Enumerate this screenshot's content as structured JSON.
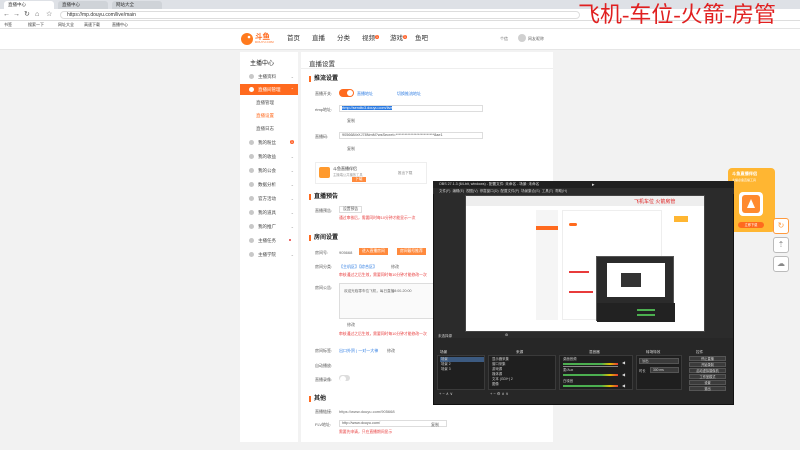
{
  "browser": {
    "tabs": [
      "直播中心",
      "直播中心",
      "网站大全"
    ],
    "url": "https://mp.douyu.com/live/main",
    "bookmarks": [
      "书签",
      "搜索一下",
      "网址大全",
      "高速下载",
      "直播中心"
    ],
    "user": "网友昵称"
  },
  "overlay_text": "飞机-车位-火箭-房管",
  "site": {
    "logo": "斗鱼",
    "logo_sub": "DOUYU.COM",
    "nav": [
      "首页",
      "直播",
      "分类",
      "视频",
      "游戏",
      "鱼吧"
    ],
    "nav_badges": {
      "视频": "1",
      "游戏": "1"
    },
    "msg": "个信"
  },
  "sidebar": {
    "title": "主播中心",
    "items": [
      {
        "label": "主播资料"
      },
      {
        "label": "直播间管理",
        "active": true
      },
      {
        "label": "直播管理",
        "sub": true
      },
      {
        "label": "直播设置",
        "sub": true,
        "active": true
      },
      {
        "label": "直播日志",
        "sub": true
      },
      {
        "label": "我的粉丝",
        "badge": "1"
      },
      {
        "label": "我的收益"
      },
      {
        "label": "我的公会"
      },
      {
        "label": "数据分析"
      },
      {
        "label": "官方活动"
      },
      {
        "label": "我的道具"
      },
      {
        "label": "我的推广"
      },
      {
        "label": "主播任务"
      },
      {
        "label": "主播学院"
      }
    ]
  },
  "main": {
    "page_title": "直播设置",
    "push": {
      "heading": "推流设置",
      "switch_label": "直播开关:",
      "link1": "直播地址",
      "link2": "切换推流地址",
      "rtmp_label": "rtmp地址:",
      "rtmp_value": "rtmp://sendtc3.douyu.com/live",
      "copy": "复制",
      "code_label": "直播码:",
      "code_value": "9056684rXJ78NmM?wsSecret=**************************8ae1",
      "helper_title": "斗鱼直播伴侣",
      "helper_desc": "主播端公共播放工具",
      "helper_btn": "下载",
      "helper_right": "推出下载"
    },
    "notice": {
      "heading": "直播预告",
      "label": "直播预告:",
      "btn": "设置预告",
      "warn": "通过审核后，需要同时每10分钟才能显示一次"
    },
    "room": {
      "heading": "房间设置",
      "id_label": "房间号:",
      "id_value": "905668",
      "btn_apply": "进入直播房间",
      "btn_seat": "房间靓号推荐",
      "cat_label": "房间分类:",
      "cat_value": "【主机区】【综合区】",
      "cat_btn": "修改",
      "cat_warn": "审核通过之后生效，需要同时每10分钟才能修改一次",
      "desc_label": "房间公告:",
      "desc_value": "欢迎光临零车位飞机，每日直播8:00-20:00",
      "edit": "修改",
      "desc_warn": "审核通过之后生效，需要同时每10分钟才能修改一次",
      "tag_label": "房间标签:",
      "tag_value": "出口外贸 | 一对一大神",
      "tag_btn": "修改",
      "auto_label": "自动播放:",
      "record_label": "直播录像:"
    },
    "other": {
      "heading": "其他",
      "link_label": "直播链接:",
      "link_value": "https://www.douyu.com/905668",
      "share_label": "FLV地址:",
      "share_value": "http://www.douyu.com/",
      "share_btn": "复制",
      "share_warn": "需要先申请，只在直播期间显示"
    }
  },
  "obs": {
    "title": "OBS 27.1.3 (64-bit, windows) - 配置文件: 未命名 - 场景: 未命名",
    "menu": [
      "文件(F)",
      "编辑(E)",
      "视图(V)",
      "停靠窗口(D)",
      "配置文件(P)",
      "场景集合(S)",
      "工具(T)",
      "帮助(H)"
    ],
    "preview_overlay": "飞机车位  火箭房管",
    "scene_label": "未选择源",
    "docks": {
      "scenes": "场景",
      "sources": "来源",
      "mixer": "混音器",
      "transitions": "转场特效",
      "controls": "控件"
    },
    "scene_items": [
      "场景",
      "场景 2",
      "场景 3"
    ],
    "source_items": [
      "显示器采集",
      "窗口采集",
      "游戏源",
      "媒体源",
      "文本 (GDI+) 2",
      "图像"
    ],
    "mixer_items": [
      "桌面音频",
      "麦/Aux",
      "白噪音"
    ],
    "transition": "淡出",
    "duration_label": "时长",
    "duration": "300 ms",
    "controls": [
      "停止直播",
      "开始录制",
      "启动虚拟摄像机",
      "工作室模式",
      "设置",
      "退出"
    ]
  },
  "promo": {
    "title": "斗鱼直播伴侣",
    "sub": "主播必备直播工具",
    "btn": "立即下载"
  },
  "colors": {
    "accent": "#ff6a1e",
    "link": "#2a7ae2",
    "warn": "#e83b3b",
    "overlay": "#e02020"
  }
}
